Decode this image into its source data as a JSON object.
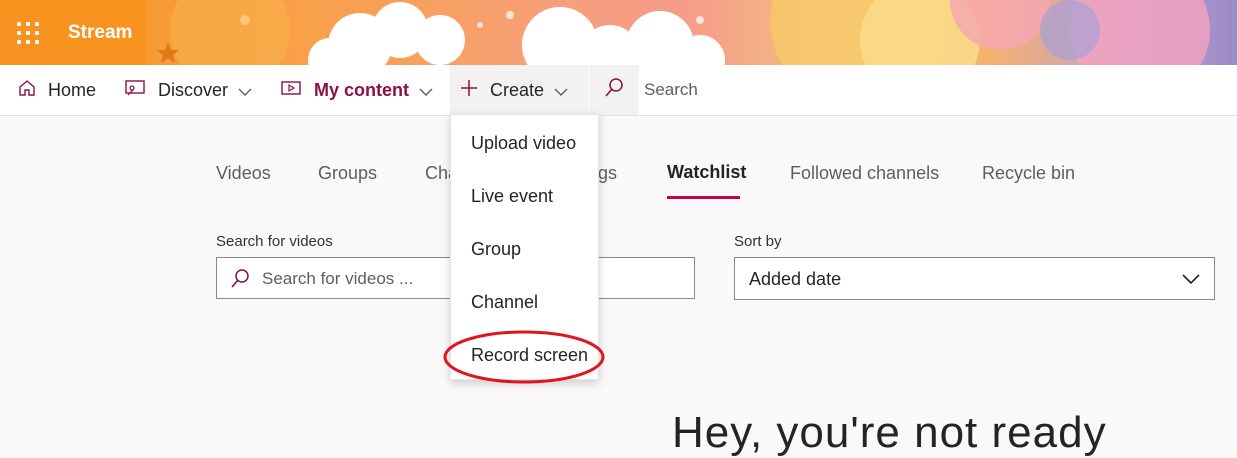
{
  "app": {
    "name": "Stream"
  },
  "nav": {
    "home": "Home",
    "discover": "Discover",
    "my_content": "My content",
    "create": "Create",
    "search": "Search"
  },
  "tabs": [
    {
      "label": "Videos"
    },
    {
      "label": "Groups"
    },
    {
      "label": "Cha"
    },
    {
      "label": "gs"
    },
    {
      "label": "Watchlist"
    },
    {
      "label": "Followed channels"
    },
    {
      "label": "Recycle bin"
    }
  ],
  "filters": {
    "search_label": "Search for videos",
    "search_placeholder": "Search for videos ...",
    "sort_label": "Sort by",
    "sort_value": "Added date"
  },
  "create_menu": {
    "items": [
      {
        "label": "Upload video"
      },
      {
        "label": "Live event"
      },
      {
        "label": "Group"
      },
      {
        "label": "Channel"
      },
      {
        "label": "Record screen"
      }
    ]
  },
  "main": {
    "heading_partial": "Hey, you're not ready"
  },
  "colors": {
    "brand": "#f7931e",
    "accent": "#c30052",
    "highlight": "#e0141e"
  }
}
